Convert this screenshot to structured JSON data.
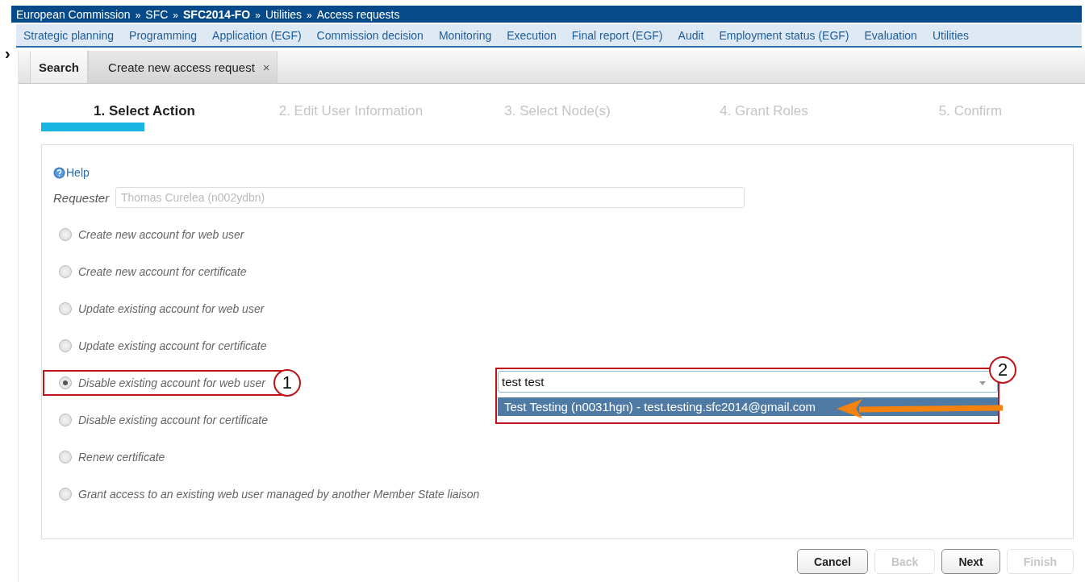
{
  "breadcrumb": [
    {
      "label": "European Commission",
      "bold": false
    },
    {
      "label": "SFC",
      "bold": false
    },
    {
      "label": "SFC2014-FO",
      "bold": true
    },
    {
      "label": "Utilities",
      "bold": false
    },
    {
      "label": "Access requests",
      "bold": false
    }
  ],
  "breadcrumb_separator": "»",
  "menu": [
    "Strategic planning",
    "Programming",
    "Application (EGF)",
    "Commission decision",
    "Monitoring",
    "Execution",
    "Final report (EGF)",
    "Audit",
    "Employment status (EGF)",
    "Evaluation",
    "Utilities"
  ],
  "sidebar_toggle": "›",
  "tabs": [
    {
      "label": "Search",
      "selected": false
    },
    {
      "label": "Create new access request",
      "selected": true,
      "close": "×"
    }
  ],
  "steps": [
    {
      "label": "1. Select Action",
      "selected": true
    },
    {
      "label": "2. Edit User Information",
      "selected": false
    },
    {
      "label": "3. Select Node(s)",
      "selected": false
    },
    {
      "label": "4. Grant Roles",
      "selected": false
    },
    {
      "label": "5. Confirm",
      "selected": false
    }
  ],
  "help": "Help",
  "requester": {
    "label": "Requester",
    "value": "Thomas Curelea (n002ydbn)"
  },
  "options": [
    {
      "label": "Create new account for web user",
      "selected": false
    },
    {
      "label": "Create new account for certificate",
      "selected": false
    },
    {
      "label": "Update existing account for web user",
      "selected": false
    },
    {
      "label": "Update existing account for certificate",
      "selected": false
    },
    {
      "label": "Disable existing account for web user",
      "selected": true
    },
    {
      "label": "Disable existing account for certificate",
      "selected": false
    },
    {
      "label": "Renew certificate",
      "selected": false
    },
    {
      "label": "Grant access to an existing web user managed by another Member State liaison",
      "selected": false
    }
  ],
  "user_select": {
    "value": "test test",
    "suggestions": [
      "Test Testing (n0031hgn) - test.testing.sfc2014@gmail.com"
    ]
  },
  "callouts": [
    "1",
    "2"
  ],
  "buttons": [
    {
      "label": "Cancel",
      "disabled": false
    },
    {
      "label": "Back",
      "disabled": true
    },
    {
      "label": "Next",
      "disabled": false
    },
    {
      "label": "Finish",
      "disabled": true
    }
  ]
}
